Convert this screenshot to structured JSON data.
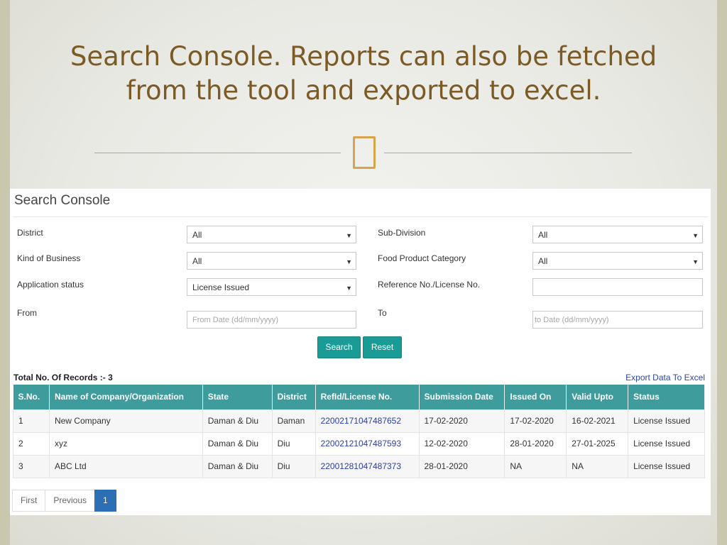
{
  "slide": {
    "title_line1": "Search Console. Reports can also be fetched",
    "title_line2": "from the  tool and exported to excel.",
    "divider_icon": "rectangle-glyph-icon"
  },
  "console": {
    "title": "Search Console",
    "fields": {
      "district": {
        "label": "District",
        "value": "All"
      },
      "sub_division": {
        "label": "Sub-Division",
        "value": "All"
      },
      "kind_of_business": {
        "label": "Kind of Business",
        "value": "All"
      },
      "food_product_category": {
        "label": "Food Product Category",
        "value": "All"
      },
      "application_status": {
        "label": "Application status",
        "value": "License Issued"
      },
      "reference_no": {
        "label": "Reference No./License No.",
        "value": ""
      },
      "from": {
        "label": "From",
        "placeholder": "From Date (dd/mm/yyyy)"
      },
      "to": {
        "label": "To",
        "placeholder": "to Date (dd/mm/yyyy)"
      }
    },
    "buttons": {
      "search": "Search",
      "reset": "Reset"
    },
    "records_label": "Total No. Of Records :- 3",
    "export_label": "Export Data To Excel",
    "table": {
      "headers": [
        "S.No.",
        "Name of Company/Organization",
        "State",
        "District",
        "RefId/License No.",
        "Submission Date",
        "Issued On",
        "Valid Upto",
        "Status"
      ],
      "rows": [
        [
          "1",
          "New Company",
          "Daman & Diu",
          "Daman",
          "22002171047487652",
          "17-02-2020",
          "17-02-2020",
          "16-02-2021",
          "License Issued"
        ],
        [
          "2",
          "xyz",
          "Daman & Diu",
          "Diu",
          "22002121047487593",
          "12-02-2020",
          "28-01-2020",
          "27-01-2025",
          "License Issued"
        ],
        [
          "3",
          "ABC Ltd",
          "Daman & Diu",
          "Diu",
          "22001281047487373",
          "28-01-2020",
          "NA",
          "NA",
          "License Issued"
        ]
      ]
    },
    "pagination": {
      "first": "First",
      "previous": "Previous",
      "current": "1"
    }
  },
  "colors": {
    "title": "#7b5a24",
    "accent": "#1a9b95",
    "header": "#3e9c9c",
    "link": "#2a47a6",
    "page_active": "#2d6fb5"
  }
}
